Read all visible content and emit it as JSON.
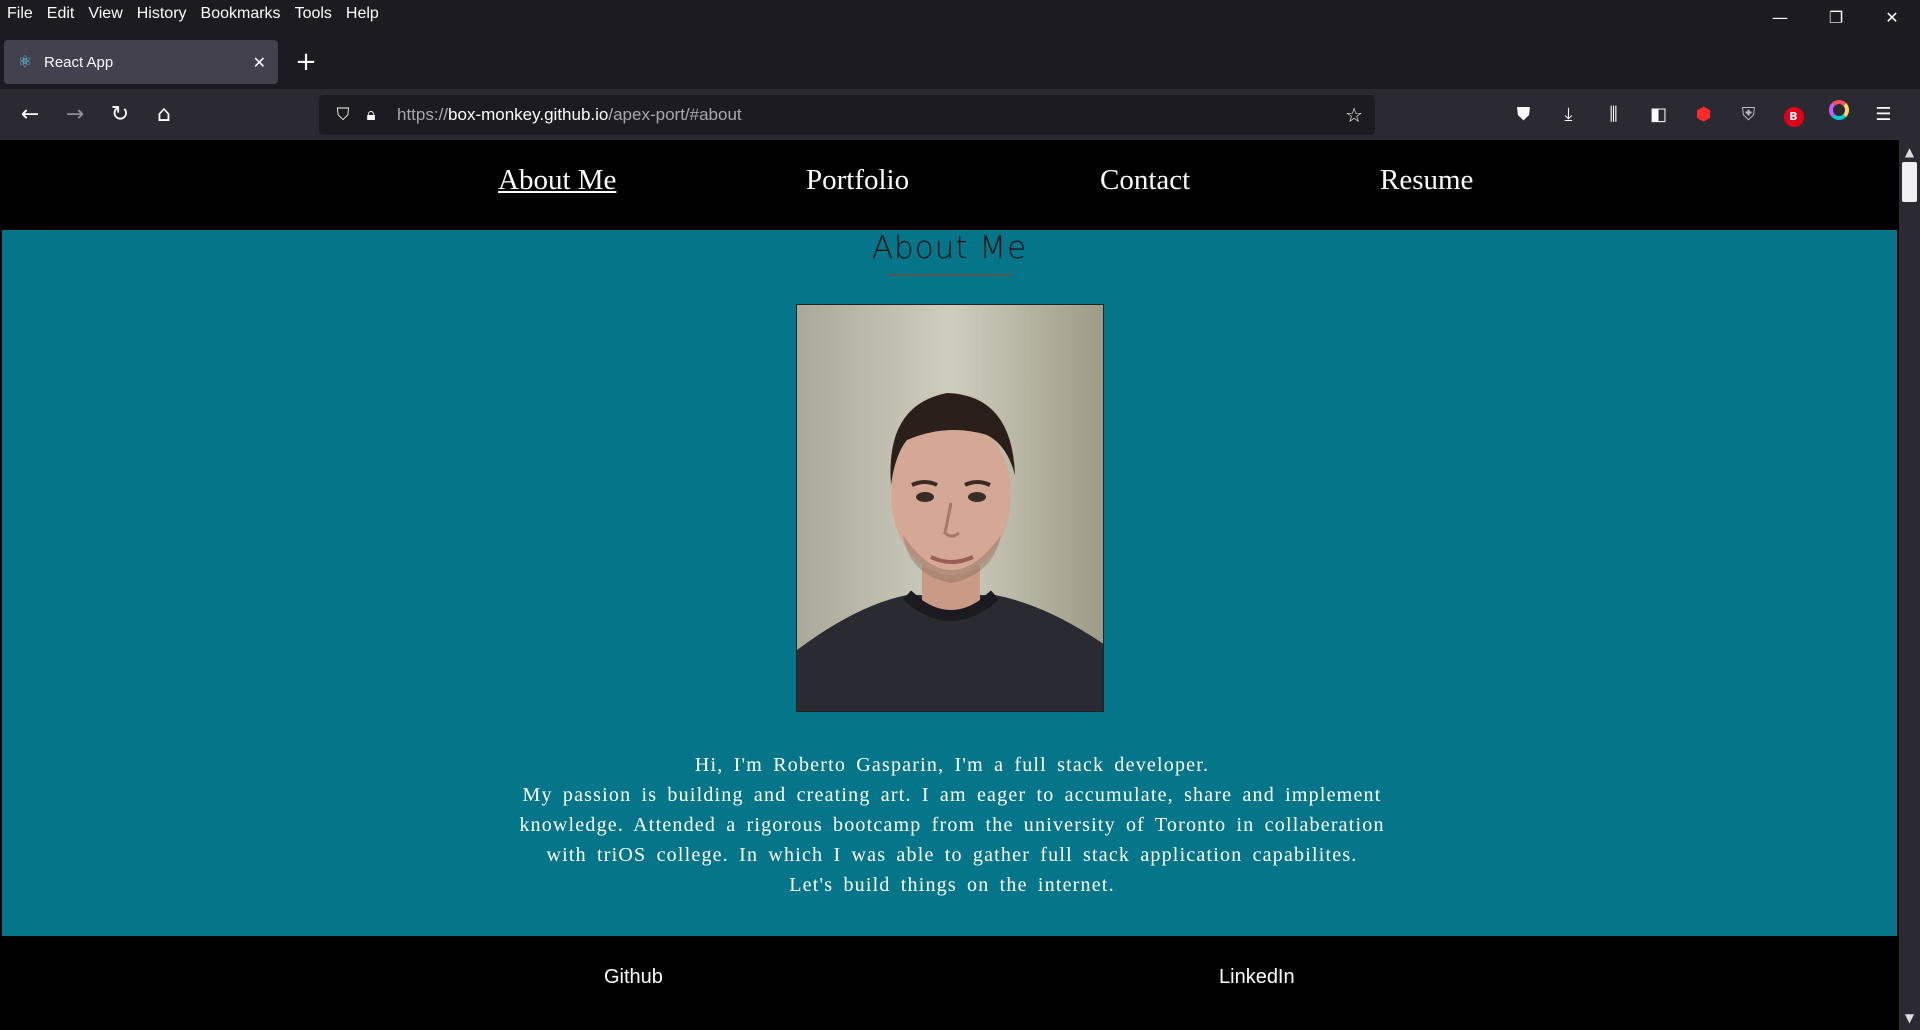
{
  "menubar": [
    "File",
    "Edit",
    "View",
    "History",
    "Bookmarks",
    "Tools",
    "Help"
  ],
  "window_controls": {
    "minimize": "—",
    "restore": "❐",
    "close": "✕"
  },
  "tab": {
    "title": "React App",
    "close": "✕"
  },
  "new_tab": "+",
  "nav": {
    "back": "←",
    "forward": "→",
    "reload": "↻",
    "home": "⌂"
  },
  "url": {
    "scheme": "https://",
    "host": "box-monkey.github.io",
    "path": "/apex-port/#about"
  },
  "toolbar_icons": [
    "pocket-icon",
    "downloads-icon",
    "library-icon",
    "sidebar-icon",
    "ublock-icon",
    "shield-extension-icon",
    "bitwarden-icon",
    "color-extension-icon",
    "menu-icon"
  ],
  "site": {
    "nav": [
      {
        "label": "About Me",
        "active": true
      },
      {
        "label": "Portfolio",
        "active": false
      },
      {
        "label": "Contact",
        "active": false
      },
      {
        "label": "Resume",
        "active": false
      }
    ],
    "about": {
      "title": "About Me",
      "bio": [
        "Hi, I'm Roberto Gasparin, I'm a full stack developer.",
        "My passion is building and creating art. I am eager to accumulate, share and implement",
        "knowledge. Attended a rigorous bootcamp from the university of Toronto in collaberation",
        "with triOS college. In which I was able to gather full stack application capabilites.",
        "Let's build things on the internet."
      ]
    },
    "footer": [
      "Github",
      "LinkedIn"
    ]
  },
  "colors": {
    "about_bg": "#057689",
    "page_bg": "#000000",
    "chrome_bg": "#1c1b22"
  }
}
